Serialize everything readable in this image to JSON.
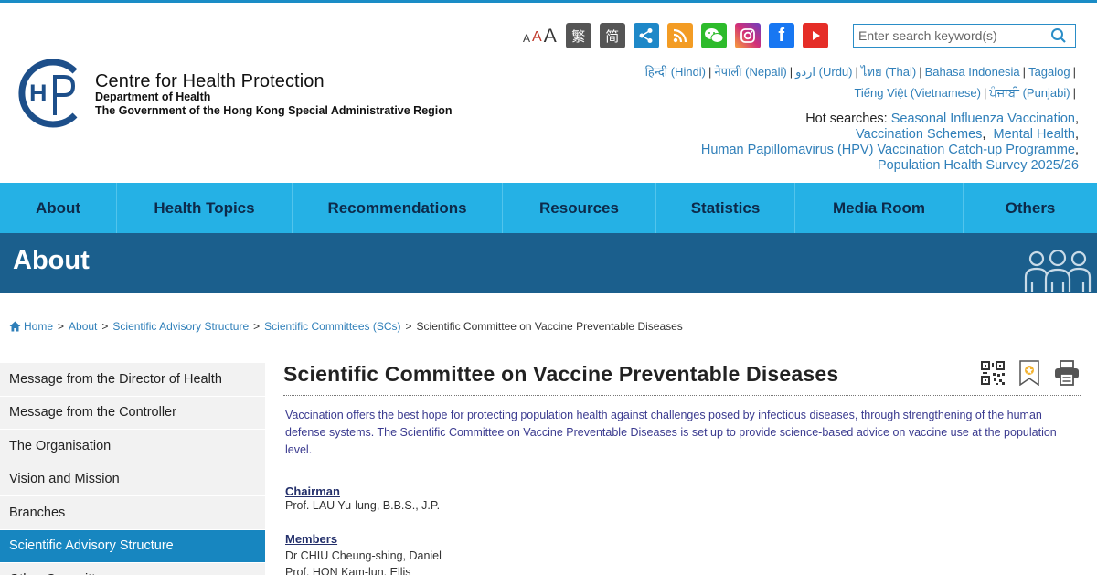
{
  "header": {
    "org_name": "Centre for Health Protection",
    "dept": "Department of Health",
    "gov": "The Government of the Hong Kong Special Administrative Region",
    "font_sizes": [
      "A",
      "A",
      "A"
    ],
    "lang_trad": "繁",
    "lang_simp": "简",
    "search_placeholder": "Enter search keyword(s)",
    "languages_row1": [
      "हिन्दी (Hindi)",
      "नेपाली (Nepali)",
      "اردو (Urdu)",
      "ไทย (Thai)",
      "Bahasa Indonesia",
      "Tagalog"
    ],
    "languages_row2": [
      "Tiếng Việt (Vietnamese)",
      "ਪੰਜਾਬੀ (Punjabi)"
    ],
    "hot_label": "Hot searches:",
    "hot_links": [
      "Seasonal Influenza Vaccination",
      "Vaccination Schemes",
      "Mental Health",
      "Human Papillomavirus (HPV) Vaccination Catch-up Programme",
      "Population Health Survey 2025/26"
    ]
  },
  "icons": {
    "logo": "chp-logo",
    "share": "share-icon",
    "rss": "rss-icon",
    "wechat": "wechat-icon",
    "instagram": "instagram-icon",
    "facebook": "facebook-icon",
    "youtube": "youtube-icon",
    "search": "search-icon",
    "home": "home-icon"
  },
  "colors": {
    "nav_bg": "#25b1e5",
    "banner_bg": "#1b5f8d",
    "active_side": "#1786c0",
    "link": "#2f7fb9"
  },
  "nav": [
    "About",
    "Health Topics",
    "Recommendations",
    "Resources",
    "Statistics",
    "Media Room",
    "Others"
  ],
  "banner": {
    "title": "About"
  },
  "breadcrumb": {
    "home": "Home",
    "items": [
      "About",
      "Scientific Advisory Structure",
      "Scientific Committees (SCs)"
    ],
    "current": "Scientific Committee on Vaccine Preventable Diseases"
  },
  "sidebar": {
    "items": [
      "Message from the Director of Health",
      "Message from the Controller",
      "The Organisation",
      "Vision and Mission",
      "Branches",
      "Scientific Advisory Structure",
      "Other Committees"
    ],
    "active_index": 5
  },
  "main": {
    "title": "Scientific Committee on Vaccine Preventable Diseases",
    "intro": "Vaccination offers the best hope for protecting population health against challenges posed by infectious diseases, through strengthening of the human defense systems. The Scientific Committee on Vaccine Preventable Diseases is set up to provide science-based advice on vaccine use at the population level.",
    "chairman_label": "Chairman",
    "chairman": "Prof. LAU Yu-lung, B.B.S., J.P.",
    "members_label": "Members",
    "members": [
      "Dr CHIU Cheung-shing, Daniel",
      "Prof. HON Kam-lun, Ellis"
    ]
  }
}
